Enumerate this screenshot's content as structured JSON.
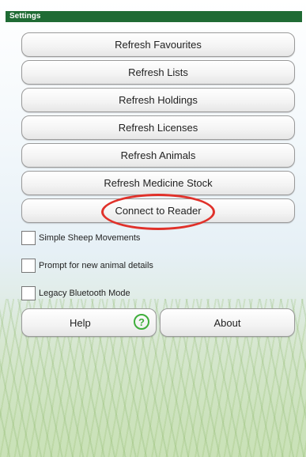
{
  "title": "Settings",
  "buttons": {
    "refresh_favourites": "Refresh Favourites",
    "refresh_lists": "Refresh Lists",
    "refresh_holdings": "Refresh Holdings",
    "refresh_licenses": "Refresh Licenses",
    "refresh_animals": "Refresh Animals",
    "refresh_medicine_stock": "Refresh Medicine Stock",
    "connect_to_reader": "Connect to Reader",
    "help": "Help",
    "about": "About"
  },
  "checkboxes": {
    "simple_sheep_movements": {
      "label": "Simple Sheep Movements",
      "checked": false
    },
    "prompt_new_animal_details": {
      "label": "Prompt for new animal details",
      "checked": false
    },
    "legacy_bluetooth_mode": {
      "label": "Legacy Bluetooth Mode",
      "checked": false
    }
  },
  "icons": {
    "help_icon": {
      "name": "question-circle-icon",
      "glyph": "?"
    }
  },
  "colors": {
    "title_bar": "#1f6b34",
    "highlight": "#e0312a",
    "help_icon": "#3fae3b"
  }
}
